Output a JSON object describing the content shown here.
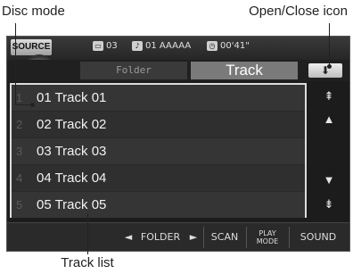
{
  "callouts": {
    "disc_mode": "Disc mode",
    "open_close_icon": "Open/Close icon",
    "track_list": "Track list"
  },
  "topbar": {
    "source_label": "SOURCE",
    "folder_number": "03",
    "track_info": "01 AAAAA",
    "time": "00'41\""
  },
  "tabs": {
    "folder": "Folder",
    "track": "Track"
  },
  "tracks": [
    {
      "num": "1",
      "name": "01 Track 01"
    },
    {
      "num": "2",
      "name": "02 Track 02"
    },
    {
      "num": "3",
      "name": "03 Track 03"
    },
    {
      "num": "4",
      "name": "04 Track 04"
    },
    {
      "num": "5",
      "name": "05 Track 05"
    }
  ],
  "bottom": {
    "prev_glyph": "◄",
    "folder": "FOLDER",
    "next_glyph": "►",
    "scan": "SCAN",
    "play_mode_line1": "PLAY",
    "play_mode_line2": "MODE",
    "sound": "SOUND"
  },
  "icons": {
    "open_close": "⬇",
    "scroll_top": "⇞",
    "scroll_up": "▲",
    "scroll_down": "▼",
    "scroll_bottom": "⇟"
  }
}
